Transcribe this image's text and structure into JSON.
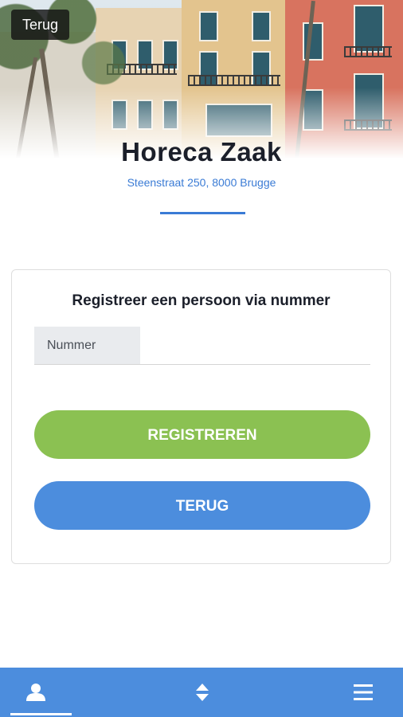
{
  "header": {
    "back_label": "Terug",
    "title": "Horeca Zaak",
    "address": "Steenstraat 250, 8000 Brugge"
  },
  "card": {
    "title": "Registreer een persoon via nummer",
    "input": {
      "label": "Nummer",
      "value": "",
      "placeholder": ""
    },
    "register_label": "REGISTREREN",
    "back_label": "TERUG"
  },
  "bottom_nav": {
    "items": [
      {
        "icon": "user-icon",
        "active": true
      },
      {
        "icon": "sort-icon",
        "active": false
      },
      {
        "icon": "menu-icon",
        "active": false
      }
    ]
  },
  "colors": {
    "accent_blue": "#4c8ddd",
    "register_green": "#8bc152",
    "address_blue": "#3a7bd5"
  }
}
